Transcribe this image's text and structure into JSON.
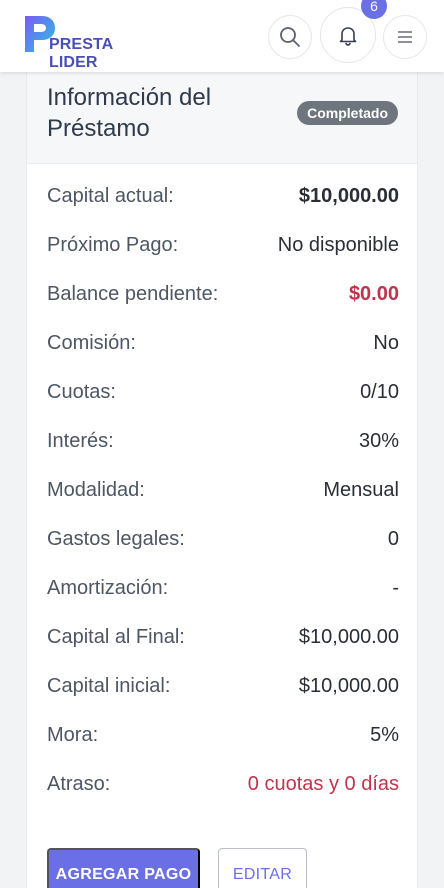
{
  "app": {
    "logo_text": "PRESTA LIDER",
    "notification_count": "6"
  },
  "card": {
    "title": "Información del Préstamo",
    "status": "Completado",
    "rows": [
      {
        "label": "Capital actual:",
        "value": "$10,000.00"
      },
      {
        "label": "Próximo Pago:",
        "value": "No disponible"
      },
      {
        "label": "Balance pendiente:",
        "value": "$0.00"
      },
      {
        "label": "Comisión:",
        "value": "No"
      },
      {
        "label": "Cuotas:",
        "value": "0/10"
      },
      {
        "label": "Interés:",
        "value": "30%"
      },
      {
        "label": "Modalidad:",
        "value": "Mensual"
      },
      {
        "label": "Gastos legales:",
        "value": "0"
      },
      {
        "label": "Amortización:",
        "value": "-"
      },
      {
        "label": "Capital al Final:",
        "value": "$10,000.00"
      },
      {
        "label": "Capital inicial:",
        "value": "$10,000.00"
      },
      {
        "label": "Mora:",
        "value": "5%"
      },
      {
        "label": "Atraso:",
        "value": "0 cuotas y 0 días"
      }
    ]
  },
  "actions": {
    "add_payment": "AGREGAR PAGO",
    "edit": "EDITAR"
  },
  "icons": {
    "search": "search-icon",
    "bell": "bell-icon",
    "menu": "hamburger-menu-icon"
  },
  "colors": {
    "accent": "#6b6fe6",
    "danger": "#c2334d",
    "status_badge": "#6e757d"
  }
}
